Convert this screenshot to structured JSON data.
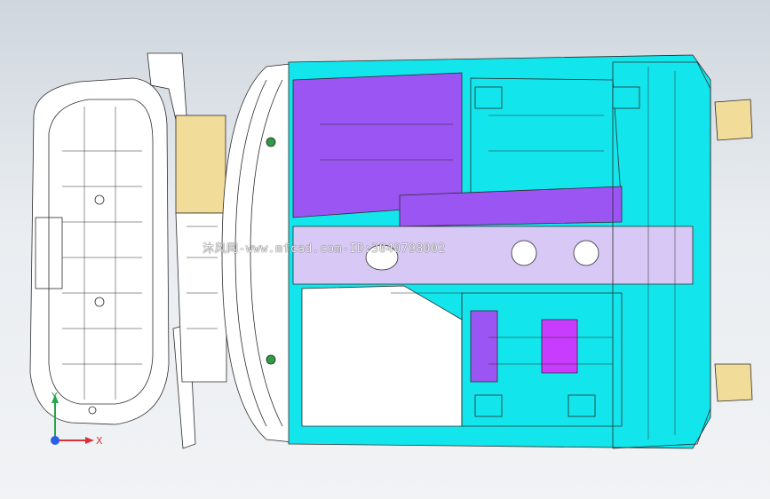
{
  "viewport": {
    "watermark_text": "沐风网-www.mfcad.com-ID:3040798002",
    "triad_x_label": "X",
    "triad_y_label": "Y",
    "background_top": "#cfd6dd",
    "background_bottom": "#f1f3f5"
  },
  "model": {
    "colors": {
      "cyan": "#12e6ec",
      "purple": "#9b55f2",
      "magenta": "#c73cff",
      "lilac": "#d8c8f5",
      "yellow": "#f1dc9a",
      "wire": "#2b2b2b",
      "white": "#ffffff"
    }
  }
}
